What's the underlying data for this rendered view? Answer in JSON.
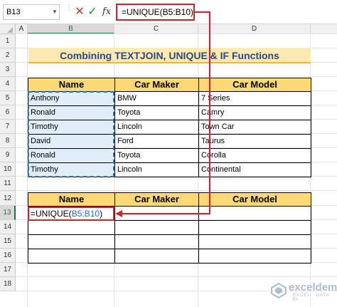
{
  "formula_bar": {
    "name_box": "B13",
    "formula": "=UNIQUE(B5:B10)"
  },
  "columns": [
    "A",
    "B",
    "C",
    "D"
  ],
  "rows": [
    "1",
    "2",
    "3",
    "4",
    "5",
    "6",
    "7",
    "8",
    "9",
    "10",
    "11",
    "12",
    "13",
    "14",
    "15",
    "16",
    "17",
    "18"
  ],
  "title": "Combining TEXTJOIN, UNIQUE & IF Functions",
  "table1": {
    "headers": [
      "Name",
      "Car Maker",
      "Car Model"
    ],
    "rows": [
      [
        "Anthony",
        "BMW",
        "7 Series"
      ],
      [
        "Ronald",
        "Toyota",
        "Camry"
      ],
      [
        "Timothy",
        "Lincoln",
        "Town Car"
      ],
      [
        "David",
        "Ford",
        "Taurus"
      ],
      [
        "Ronald",
        "Toyota",
        "Corolla"
      ],
      [
        "Timothy",
        "Lincoln",
        "Continental"
      ]
    ]
  },
  "table2": {
    "headers": [
      "Name",
      "Car Maker",
      "Car Model"
    ],
    "formula_prefix": "=UNIQUE(",
    "formula_ref": "B5:B10",
    "formula_suffix": ")"
  },
  "watermark": {
    "brand": "exceldemy",
    "tagline": "EXCEL · DATA · BI"
  },
  "colors": {
    "title_bg": "#fde9b4",
    "header_bg": "#fdd876",
    "highlight_red": "#d5202b",
    "select_blue": "#2a6ebb"
  }
}
